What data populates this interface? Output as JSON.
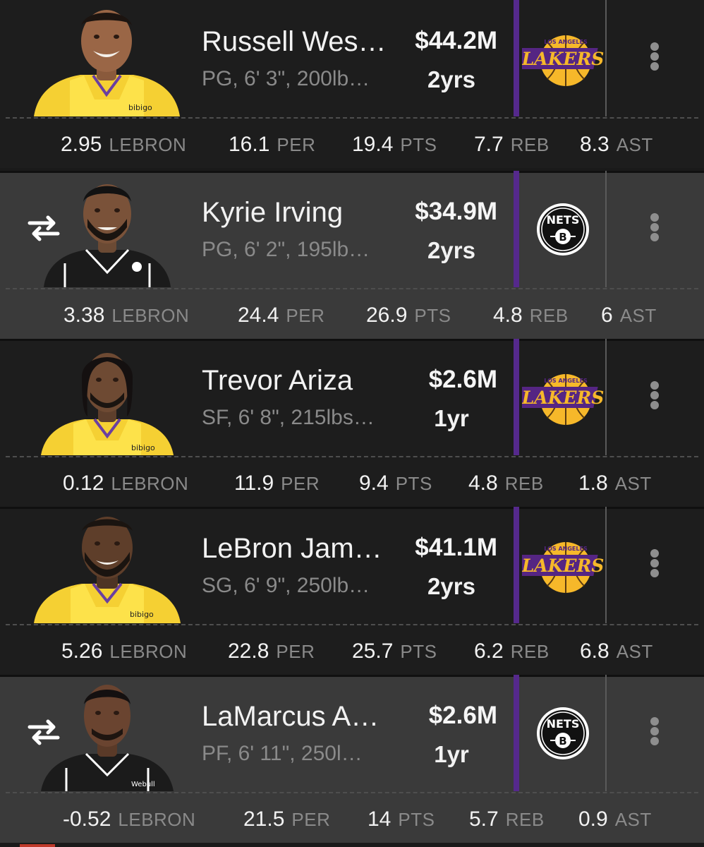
{
  "players": [
    {
      "name": "Russell Wes…",
      "info": "PG, 6' 3\", 200lb…",
      "salary": "$44.2M",
      "years": "2yrs",
      "team": "lakers",
      "swap": false,
      "jersey": "lakers",
      "stats": [
        {
          "value": "2.95",
          "label": "LEBRON"
        },
        {
          "value": "16.1",
          "label": "PER"
        },
        {
          "value": "19.4",
          "label": "PTS"
        },
        {
          "value": "7.7",
          "label": "REB"
        },
        {
          "value": "8.3",
          "label": "AST"
        }
      ]
    },
    {
      "name": "Kyrie Irving",
      "info": "PG, 6' 2\", 195lb…",
      "salary": "$34.9M",
      "years": "2yrs",
      "team": "nets",
      "swap": true,
      "jersey": "nets",
      "stats": [
        {
          "value": "3.38",
          "label": "LEBRON"
        },
        {
          "value": "24.4",
          "label": "PER"
        },
        {
          "value": "26.9",
          "label": "PTS"
        },
        {
          "value": "4.8",
          "label": "REB"
        },
        {
          "value": "6",
          "label": "AST"
        }
      ]
    },
    {
      "name": "Trevor Ariza",
      "info": "SF, 6' 8\", 215lbs…",
      "salary": "$2.6M",
      "years": "1yr",
      "team": "lakers",
      "swap": false,
      "jersey": "lakers",
      "stats": [
        {
          "value": "0.12",
          "label": "LEBRON"
        },
        {
          "value": "11.9",
          "label": "PER"
        },
        {
          "value": "9.4",
          "label": "PTS"
        },
        {
          "value": "4.8",
          "label": "REB"
        },
        {
          "value": "1.8",
          "label": "AST"
        }
      ]
    },
    {
      "name": "LeBron Jam…",
      "info": "SG, 6' 9\", 250lb…",
      "salary": "$41.1M",
      "years": "2yrs",
      "team": "lakers",
      "swap": false,
      "jersey": "lakers",
      "stats": [
        {
          "value": "5.26",
          "label": "LEBRON"
        },
        {
          "value": "22.8",
          "label": "PER"
        },
        {
          "value": "25.7",
          "label": "PTS"
        },
        {
          "value": "6.2",
          "label": "REB"
        },
        {
          "value": "6.8",
          "label": "AST"
        }
      ]
    },
    {
      "name": "LaMarcus A…",
      "info": "PF, 6' 11\", 250l…",
      "salary": "$2.6M",
      "years": "1yr",
      "team": "nets",
      "swap": true,
      "jersey": "nets",
      "stats": [
        {
          "value": "-0.52",
          "label": "LEBRON"
        },
        {
          "value": "21.5",
          "label": "PER"
        },
        {
          "value": "14",
          "label": "PTS"
        },
        {
          "value": "5.7",
          "label": "REB"
        },
        {
          "value": "0.9",
          "label": "AST"
        }
      ]
    }
  ],
  "logos": {
    "lakers": {
      "top_text": "LOS ANGELES",
      "main_text": "LAKERS"
    },
    "nets": {
      "main_text": "NETS",
      "letter": "B"
    }
  },
  "colors": {
    "purple_divider": "#55298c",
    "lakers_gold": "#f6b82a",
    "lakers_purple": "#552583",
    "card_dark": "#1d1d1d",
    "card_gray": "#3a3a3a"
  }
}
